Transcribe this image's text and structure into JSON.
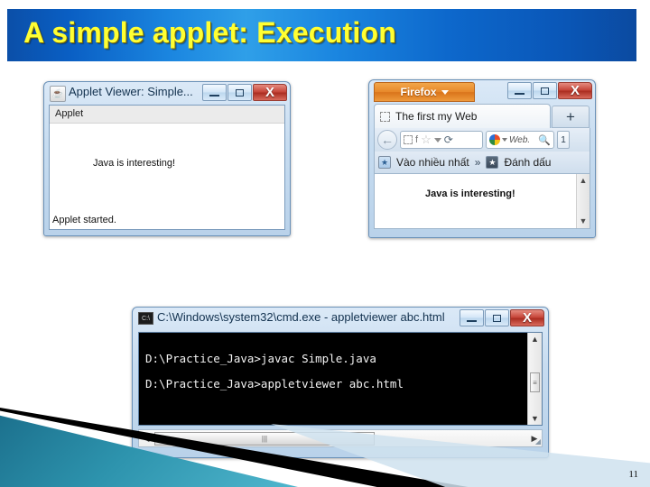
{
  "slide": {
    "title": "A simple applet: Execution",
    "page_number": "11",
    "banner_color": "#1b86e0",
    "title_color": "#ffff33"
  },
  "applet_viewer_window": {
    "icon": "java-cup-icon",
    "title": "Applet Viewer: Simple...",
    "menu_label": "Applet",
    "canvas_text": "Java is interesting!",
    "status_text": "Applet started.",
    "buttons": {
      "minimize": "minimize-icon",
      "maximize": "maximize-icon",
      "close": "X"
    }
  },
  "firefox_window": {
    "app_button_label": "Firefox",
    "tab_label": "The first my Web",
    "new_tab_label": "+",
    "navbar": {
      "back_icon": "back-arrow-icon",
      "url_favicon": "page-favicon",
      "url_f_label": "f",
      "star_icon": "☆",
      "dropdown_icon": "chevron-down-icon",
      "reload_icon": "⟳",
      "search_placeholder": "Web.",
      "search_icon": "magnifier-icon",
      "home_label": "1"
    },
    "bookmarks": [
      {
        "icon": "most-visited-icon",
        "label": "Vào nhiều nhất"
      },
      {
        "icon": "chevron-more",
        "label": "»"
      },
      {
        "icon": "bookmarks-star-icon",
        "label": "Đánh dấu"
      }
    ],
    "page_text": "Java is interesting!",
    "scroll_up": "▲",
    "scroll_down": "▼",
    "buttons": {
      "minimize": "minimize-icon",
      "maximize": "maximize-icon",
      "close": "X"
    }
  },
  "cmd_window": {
    "icon": "cmd-icon",
    "title": "C:\\Windows\\system32\\cmd.exe - appletviewer  abc.html",
    "console_lines": "D:\\Practice_Java>javac Simple.java\nD:\\Practice_Java>appletviewer abc.html",
    "scroll_up": "▲",
    "scroll_down": "▼",
    "thumb_grip": "≡",
    "hscroll_left": "◀",
    "hscroll_right": "▶",
    "hscroll_grip": "|||",
    "resize_grip": "◢",
    "buttons": {
      "minimize": "minimize-icon",
      "maximize": "maximize-icon",
      "close": "X"
    }
  }
}
